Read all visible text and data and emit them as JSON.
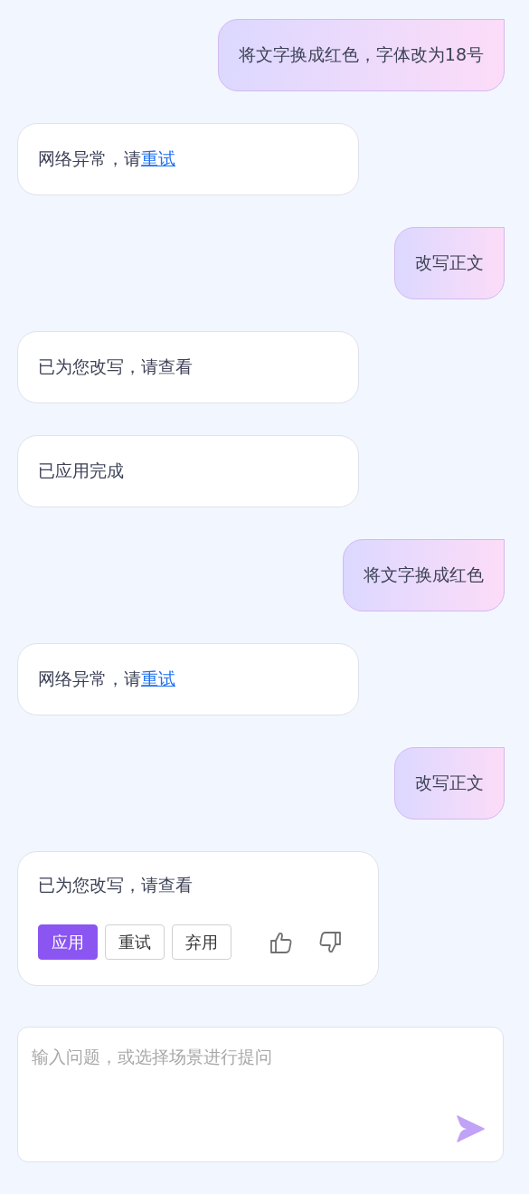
{
  "messages": [
    {
      "kind": "user",
      "text": "将文字换成红色，字体改为18号"
    },
    {
      "kind": "bot",
      "text": "网络异常，请",
      "link": "重试"
    },
    {
      "kind": "user",
      "text": "改写正文"
    },
    {
      "kind": "bot",
      "text": "已为您改写，请查看"
    },
    {
      "kind": "bot",
      "text": "已应用完成"
    },
    {
      "kind": "user",
      "text": "将文字换成红色"
    },
    {
      "kind": "bot",
      "text": "网络异常，请",
      "link": "重试"
    },
    {
      "kind": "user",
      "text": "改写正文"
    },
    {
      "kind": "bot",
      "text": "已为您改写，请查看",
      "actions": [
        {
          "label": "应用",
          "primary": true
        },
        {
          "label": "重试",
          "primary": false
        },
        {
          "label": "弃用",
          "primary": false
        }
      ],
      "feedback": true
    }
  ],
  "composer": {
    "placeholder": "输入问题，或选择场景进行提问"
  }
}
